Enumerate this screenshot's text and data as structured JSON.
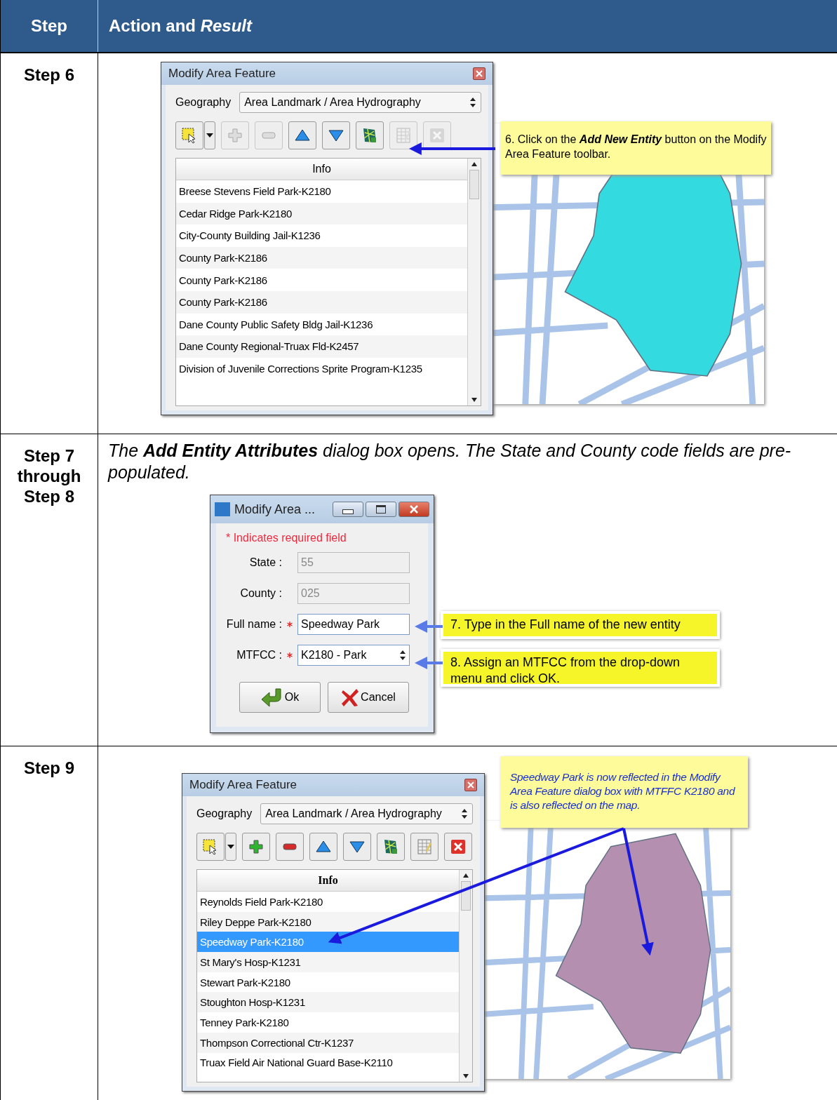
{
  "header": {
    "step": "Step",
    "action": "Action and *Result*"
  },
  "steps": [
    {
      "kind": "action",
      "label": "Step 6",
      "callout": "6. Click on the **Add New Entity** button on the Modify Area Feature toolbar.",
      "dialog": {
        "title": "Modify Area Feature",
        "geography_label": "Geography",
        "geography_value": "Area Landmark / Area Hydrography",
        "list_header": "Info",
        "header_bold": false,
        "toolbar": [
          {
            "kind": "select",
            "disabled": false
          },
          {
            "kind": "add",
            "disabled": true
          },
          {
            "kind": "remove",
            "disabled": true
          },
          {
            "kind": "up",
            "disabled": false
          },
          {
            "kind": "down",
            "disabled": false
          },
          {
            "kind": "map",
            "disabled": false
          },
          {
            "kind": "table",
            "disabled": true
          },
          {
            "kind": "delete",
            "disabled": true
          }
        ],
        "rows": [
          {
            "text": "Breese Stevens Field Park-K2180",
            "selected": false
          },
          {
            "text": "Cedar Ridge Park-K2180",
            "selected": false
          },
          {
            "text": "City-County Building Jail-K1236",
            "selected": false
          },
          {
            "text": "County Park-K2186",
            "selected": false
          },
          {
            "text": "County Park-K2186",
            "selected": false
          },
          {
            "text": "County Park-K2186",
            "selected": false
          },
          {
            "text": "Dane County Public Safety Bldg Jail-K1236",
            "selected": false
          },
          {
            "text": "Dane County Regional-Truax Fld-K2457",
            "selected": false
          },
          {
            "text": "Division of Juvenile Corrections Sprite Program-K1235",
            "selected": false
          }
        ]
      }
    },
    {
      "kind": "attributes",
      "label": "Step 7 through Step 8",
      "intro": "The **Add Entity Attributes** dialog box opens. The State and County code fields are pre-populated.",
      "dialog": {
        "title": "Modify Area ...",
        "required_note": "* Indicates required field",
        "fields": [
          {
            "kind": "text",
            "label": "State :",
            "value": "55",
            "disabled": true,
            "required": false
          },
          {
            "kind": "text",
            "label": "County :",
            "value": "025",
            "disabled": true,
            "required": false
          },
          {
            "kind": "text",
            "label": "Full name :",
            "value": "Speedway Park",
            "disabled": false,
            "required": true
          },
          {
            "kind": "select",
            "label": "MTFCC :",
            "value": "K2180 - Park",
            "disabled": false,
            "required": true
          }
        ],
        "buttons": [
          {
            "kind": "ok",
            "label": "Ok"
          },
          {
            "kind": "cancel",
            "label": "Cancel"
          }
        ]
      },
      "callouts": [
        "7. Type in the Full name of the new entity",
        "8. Assign an MTFCC from the drop-down menu and click OK."
      ]
    },
    {
      "kind": "result",
      "label": "Step 9",
      "callout": "Speedway Park is now reflected in the Modify Area Feature dialog box with MTFFC K2180 and is also reflected on the map.",
      "dialog": {
        "title": "Modify Area Feature",
        "geography_label": "Geography",
        "geography_value": "Area Landmark / Area Hydrography",
        "list_header": "Info",
        "header_bold": true,
        "toolbar": [
          {
            "kind": "select",
            "disabled": false
          },
          {
            "kind": "add",
            "disabled": false
          },
          {
            "kind": "remove",
            "disabled": false
          },
          {
            "kind": "up",
            "disabled": false
          },
          {
            "kind": "down",
            "disabled": false
          },
          {
            "kind": "map",
            "disabled": false
          },
          {
            "kind": "table",
            "disabled": false
          },
          {
            "kind": "delete",
            "disabled": false
          }
        ],
        "rows": [
          {
            "text": "Reynolds Field Park-K2180",
            "selected": false
          },
          {
            "text": "Riley Deppe Park-K2180",
            "selected": false
          },
          {
            "text": "Speedway Park-K2180",
            "selected": true
          },
          {
            "text": "St Mary's Hosp-K1231",
            "selected": false
          },
          {
            "text": "Stewart Park-K2180",
            "selected": false
          },
          {
            "text": "Stoughton Hosp-K1231",
            "selected": false
          },
          {
            "text": "Tenney Park-K2180",
            "selected": false
          },
          {
            "text": "Thompson Correctional Ctr-K1237",
            "selected": false
          },
          {
            "text": "Truax Field Air National Guard Base-K2110",
            "selected": false
          }
        ]
      }
    }
  ]
}
